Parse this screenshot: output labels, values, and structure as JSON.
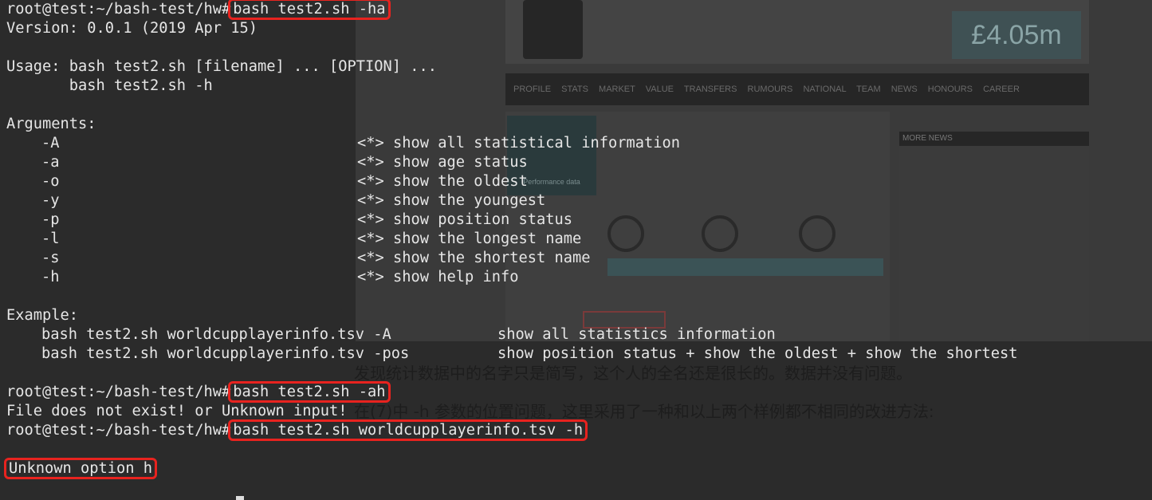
{
  "terminal": {
    "prompt": "root@test:~/bash-test/hw#",
    "cmd1": "bash test2.sh -ha",
    "version": "Version: 0.0.1 (2019 Apr 15)",
    "usage1": "Usage: bash test2.sh [filename] ... [OPTION] ...",
    "usage2": "       bash test2.sh -h",
    "args_title": "Arguments:",
    "args": [
      {
        "flag": "-A",
        "desc": "<*> show all statistical information"
      },
      {
        "flag": "-a",
        "desc": "<*> show age status"
      },
      {
        "flag": "-o",
        "desc": "<*> show the oldest"
      },
      {
        "flag": "-y",
        "desc": "<*> show the youngest"
      },
      {
        "flag": "-p",
        "desc": "<*> show position status"
      },
      {
        "flag": "-l",
        "desc": "<*> show the longest name"
      },
      {
        "flag": "-s",
        "desc": "<*> show the shortest name"
      },
      {
        "flag": "-h",
        "desc": "<*> show help info"
      }
    ],
    "example_title": "Example:",
    "examples": [
      {
        "cmd": "bash test2.sh worldcupplayerinfo.tsv -A",
        "desc": "show all statistics information"
      },
      {
        "cmd": "bash test2.sh worldcupplayerinfo.tsv -pos",
        "desc": "show position status + show the oldest + show the shortest"
      }
    ],
    "cmd2": "bash test2.sh -ah",
    "error1": "File does not exist! or Unknown input!",
    "cmd3": "bash test2.sh worldcupplayerinfo.tsv -h",
    "error2": "Unknown option h"
  },
  "background": {
    "price": "£4.05m",
    "nav_items": [
      "PROFILE",
      "STATS",
      "MARKET VALUE",
      "TRANSFERS",
      "RUMOURS",
      "NATIONAL TEAM",
      "NEWS",
      "HONOURS",
      "CAREER"
    ],
    "panel_label": "Performance data",
    "side_header": "MORE NEWS",
    "cn_line1": "发现统计数据中的名字只是简写，这个人的全名还是很长的。数据并没有问题。",
    "cn_line2": "在(7)中 -h 参数的位置问题，这里采用了一种和以上两个样例都不相同的改进方法:"
  }
}
